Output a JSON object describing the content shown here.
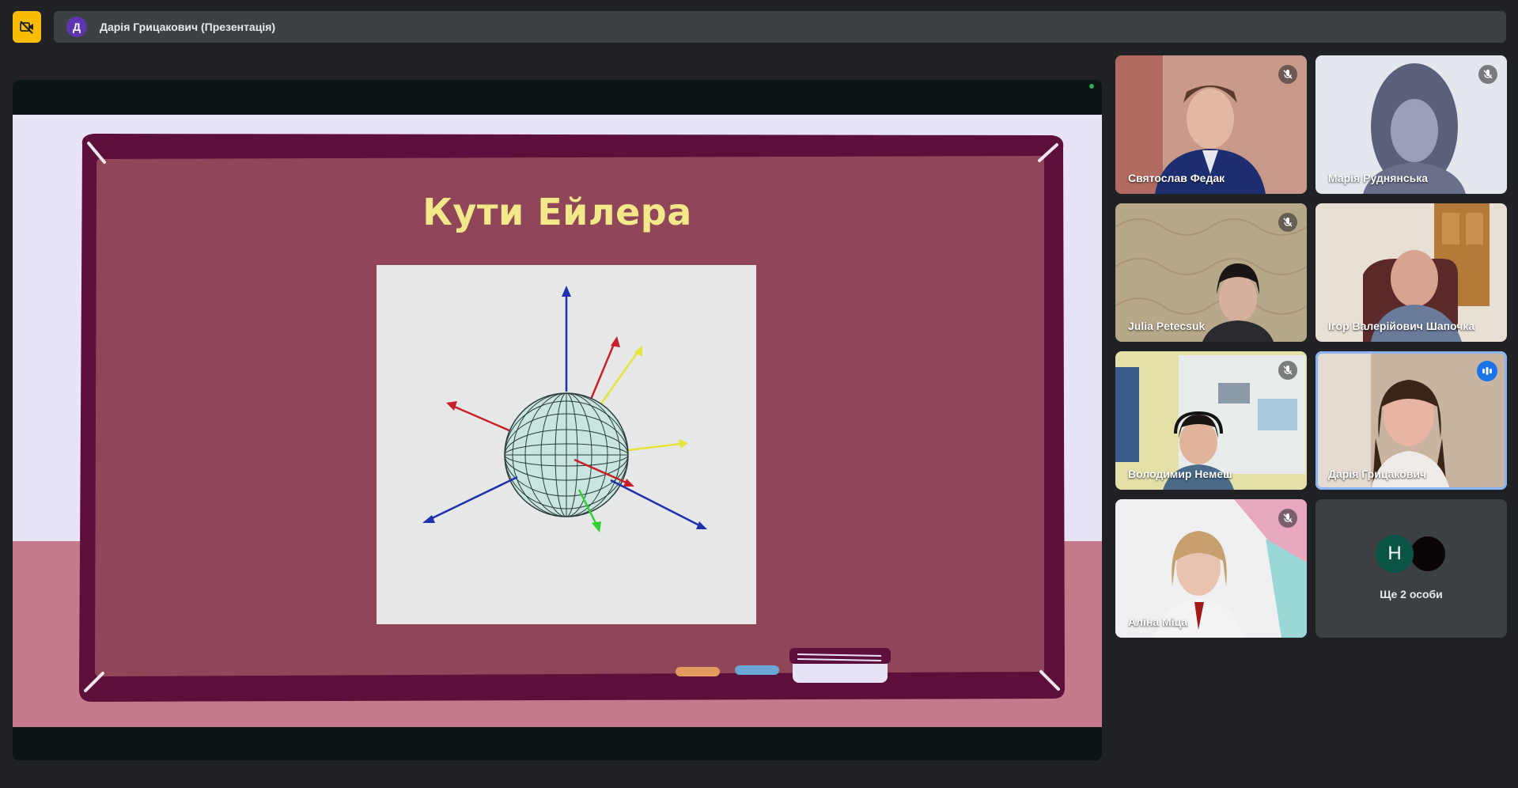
{
  "topbar": {
    "presenter_initial": "Д",
    "presenter_label": "Дарія Грицакович (Презентація)"
  },
  "slide": {
    "title": "Кути Ейлера"
  },
  "participants": [
    {
      "name": "Святослав Федак",
      "muted": true
    },
    {
      "name": "Марія Руднянська",
      "muted": true
    },
    {
      "name": "Julia Petecsuk",
      "muted": true
    },
    {
      "name": "Ігор Валерійович Шапочка",
      "muted": false
    },
    {
      "name": "Володимир Немеш",
      "muted": true
    },
    {
      "name": "Дарія Грицакович",
      "muted": false,
      "speaking": true
    },
    {
      "name": "Аліна Міца",
      "muted": true
    }
  ],
  "more": {
    "avatar_initial": "H",
    "label": "Ще 2 особи"
  },
  "colors": {
    "accent": "#fbbc04",
    "speaking": "#1a73e8",
    "board": "#8f4659",
    "board_frame": "#5c0f3a",
    "title_text": "#f4e98a"
  },
  "icons": {
    "camera_off": "camera-off-icon",
    "mic_off": "mic-off-icon",
    "speaking": "audio-bars-icon"
  }
}
